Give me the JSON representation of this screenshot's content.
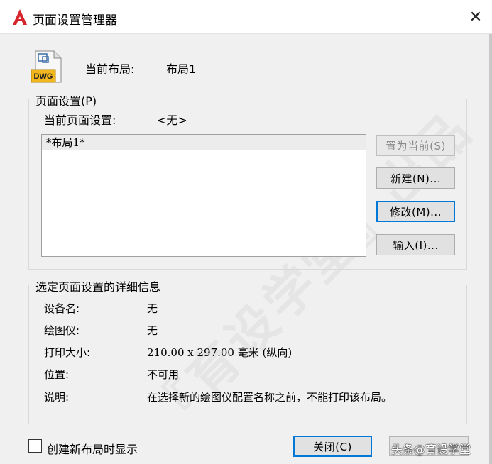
{
  "window": {
    "title": "页面设置管理器",
    "close_glyph": "✕"
  },
  "current_layout": {
    "label": "当前布局:",
    "value": "布局1",
    "icon_text": "DWG"
  },
  "page_setup_group": {
    "legend": "页面设置(P)",
    "current_label": "当前页面设置:",
    "current_value": "<无>",
    "list_items": [
      "*布局1*"
    ],
    "buttons": {
      "set_current": "置为当前(S)",
      "new": "新建(N)...",
      "modify": "修改(M)...",
      "import": "输入(I)..."
    }
  },
  "details_group": {
    "legend": "选定页面设置的详细信息",
    "rows": [
      {
        "key": "设备名:",
        "value": "无"
      },
      {
        "key": "绘图仪:",
        "value": "无"
      },
      {
        "key": "打印大小:",
        "value": "210.00 x 297.00 毫米 (纵向)"
      },
      {
        "key": "位置:",
        "value": "不可用"
      },
      {
        "key": "说明:",
        "value": "在选择新的绘图仪配置名称之前，不能打印该布局。"
      }
    ]
  },
  "footer": {
    "show_on_new_layout_label": "创建新布局时显示",
    "show_on_new_layout_checked": false,
    "close_button": "关闭(C)",
    "overlay_text": "头条@育设学堂"
  },
  "watermark": {
    "text": "『育设学堂』出品"
  },
  "colors": {
    "accent": "#0078d7",
    "app_icon_red": "#d6262d",
    "dwg_yellow": "#f2b61f"
  }
}
